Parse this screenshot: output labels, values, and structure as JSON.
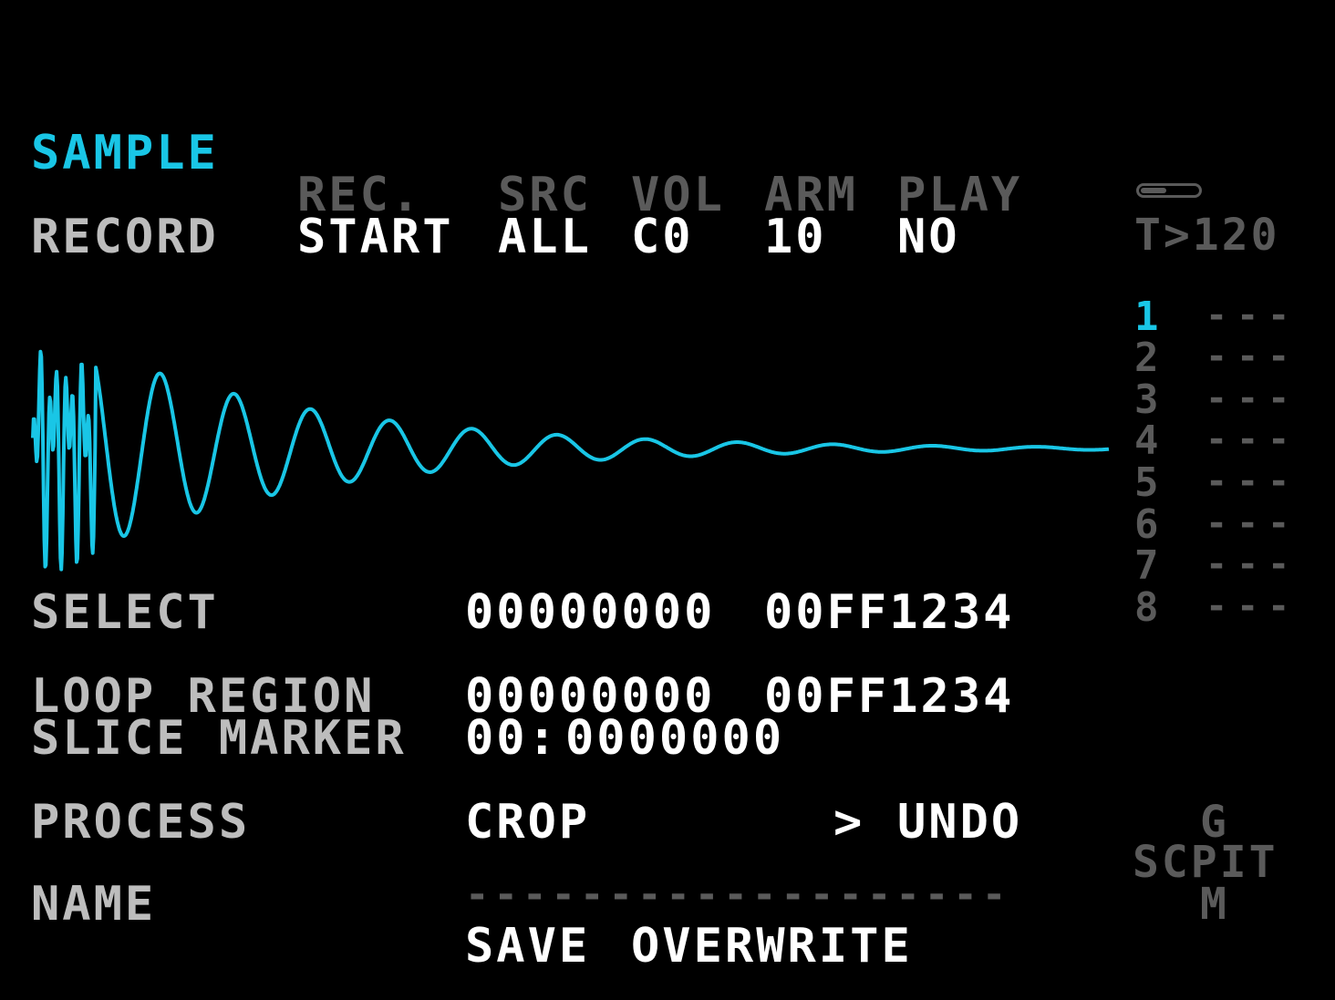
{
  "screen": {
    "title": "SAMPLE"
  },
  "record": {
    "label": "RECORD",
    "headers": [
      "REC.",
      "SRC",
      "VOL",
      "ARM",
      "PLAY"
    ],
    "values": [
      "START",
      "ALL",
      "C0",
      "10",
      "NO"
    ]
  },
  "status": {
    "tempo": "T>120"
  },
  "slots": {
    "numbers": [
      "1",
      "2",
      "3",
      "4",
      "5",
      "6",
      "7",
      "8"
    ],
    "values": [
      "---",
      "---",
      "---",
      "---",
      "---",
      "---",
      "---",
      "---"
    ],
    "active": "1"
  },
  "select": {
    "label": "SELECT",
    "start": "00000000",
    "end": "00FF1234"
  },
  "loop_region": {
    "label": "LOOP REGION",
    "start": "00000000",
    "end": "00FF1234"
  },
  "slice_marker": {
    "label": "SLICE MARKER",
    "index": "00:",
    "value": "0000000"
  },
  "process": {
    "label": "PROCESS",
    "action": "CROP",
    "cursor": ">",
    "undo": "UNDO"
  },
  "name": {
    "label": "NAME",
    "value": "-------------------",
    "save": "SAVE",
    "overwrite": "OVERWRITE"
  },
  "mode_keys": {
    "top": "G",
    "middle": "SCPIT",
    "bottom": "M"
  },
  "colors": {
    "accent": "#19c6e6",
    "label": "#bdbdbd",
    "dim": "#5a5a5a",
    "value": "#ffffff",
    "background": "#000000"
  },
  "icons": {
    "battery": "battery-icon"
  }
}
